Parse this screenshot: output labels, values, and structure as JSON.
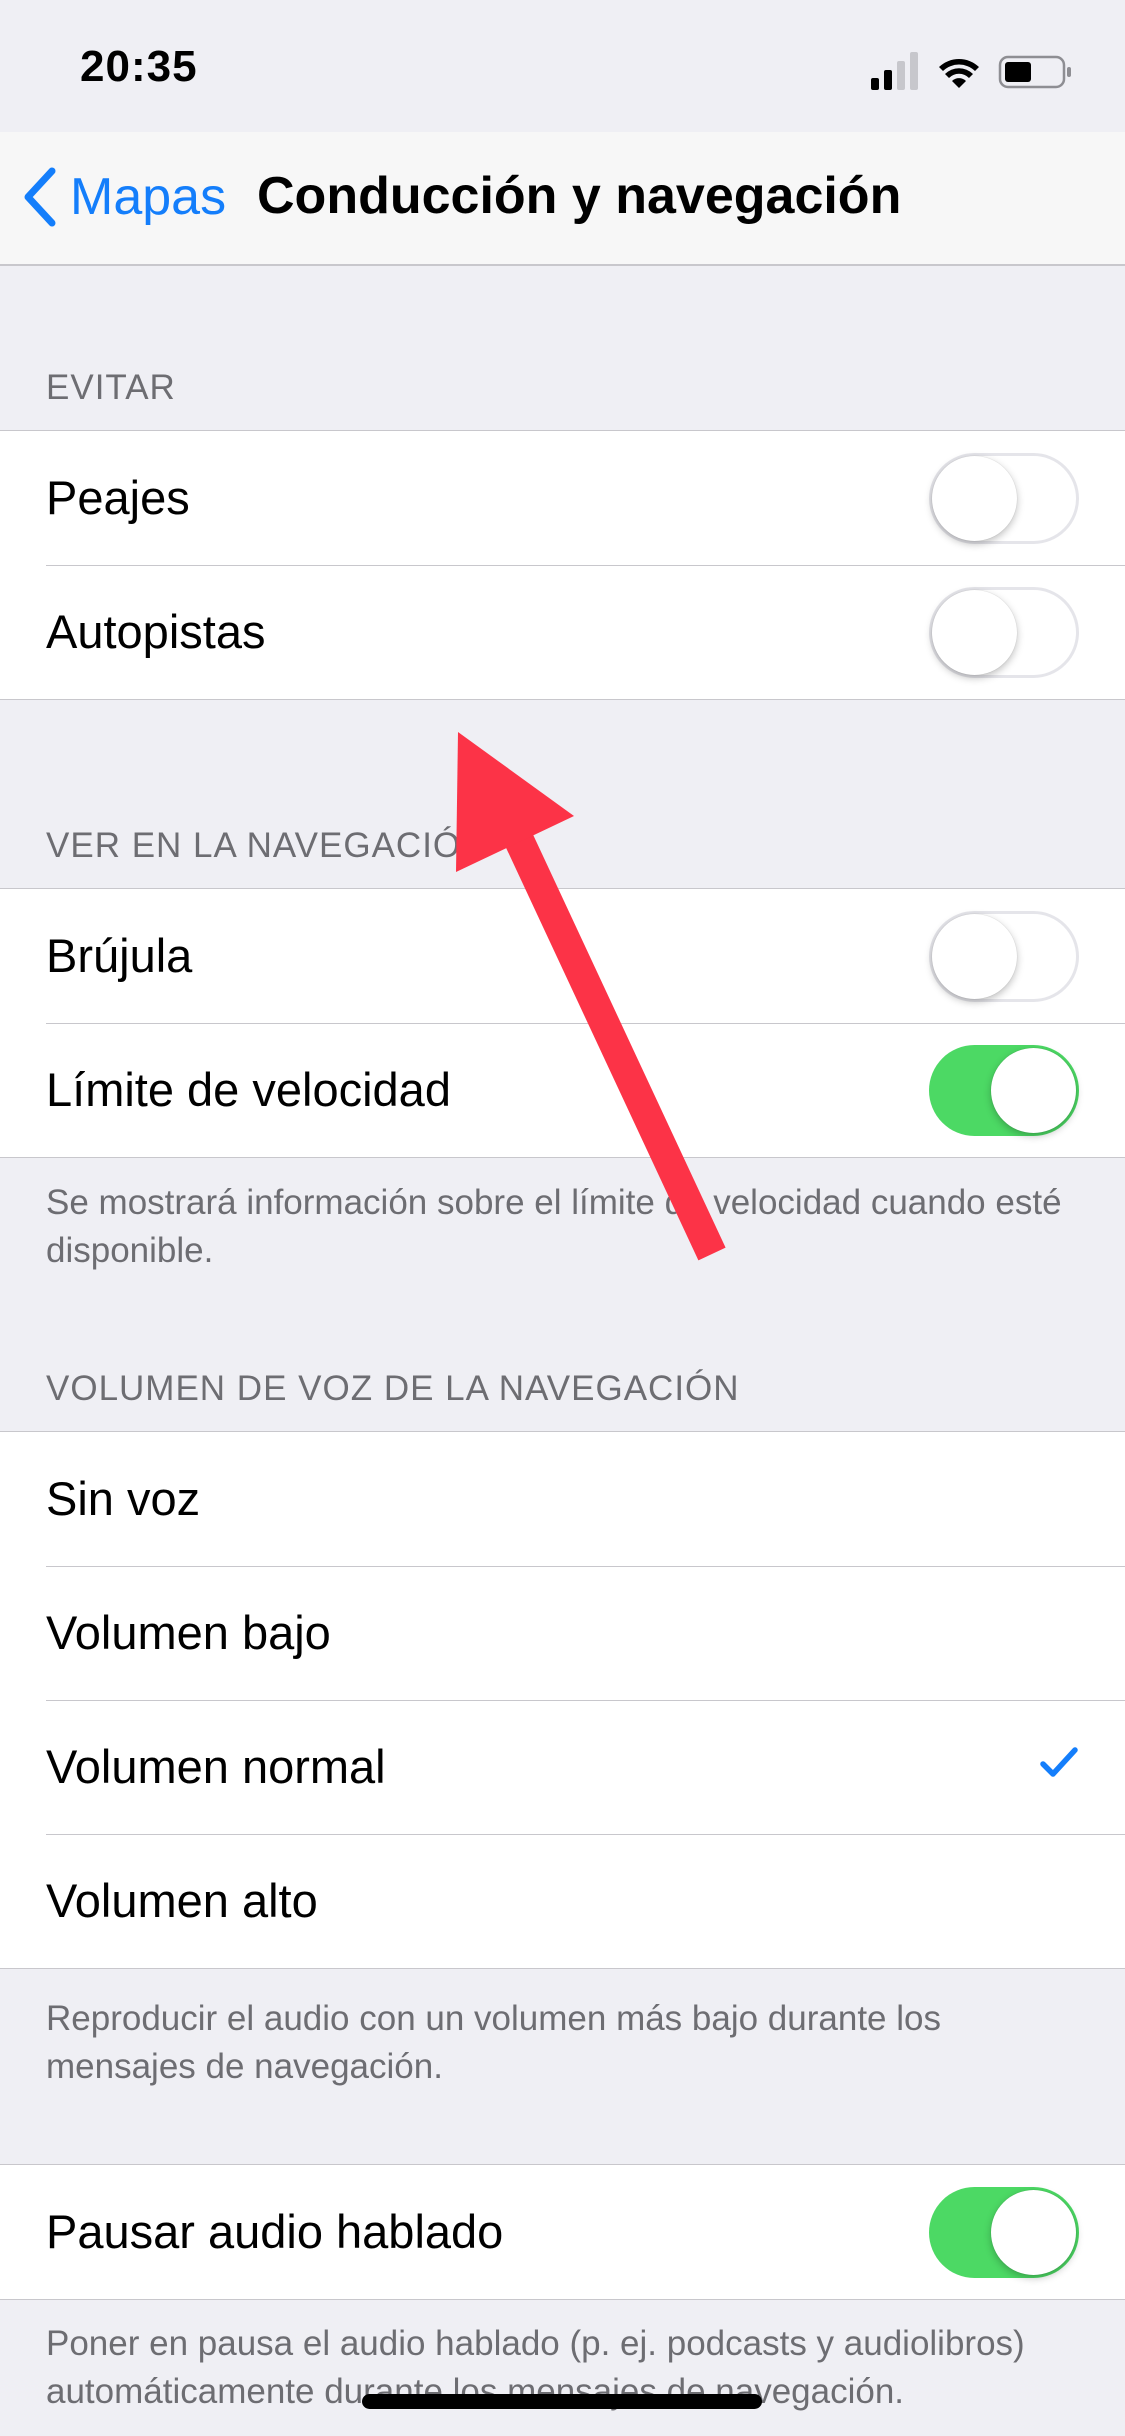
{
  "status_bar": {
    "time": "20:35"
  },
  "nav": {
    "back_label": "Mapas",
    "title": "Conducción y navegación"
  },
  "sections": {
    "avoid": {
      "header": "EVITAR",
      "rows": [
        {
          "label": "Peajes",
          "toggle": "off"
        },
        {
          "label": "Autopistas",
          "toggle": "off"
        }
      ]
    },
    "show": {
      "header": "VER EN LA NAVEGACIÓN",
      "rows": [
        {
          "label": "Brújula",
          "toggle": "off"
        },
        {
          "label": "Límite de velocidad",
          "toggle": "on"
        }
      ],
      "footer": "Se mostrará información sobre el límite de velocidad cuando esté disponible."
    },
    "volume": {
      "header": "VOLUMEN DE VOZ DE LA NAVEGACIÓN",
      "options": [
        {
          "label": "Sin voz",
          "selected": false
        },
        {
          "label": "Volumen bajo",
          "selected": false
        },
        {
          "label": "Volumen normal",
          "selected": true
        },
        {
          "label": "Volumen alto",
          "selected": false
        }
      ],
      "footer": "Reproducir el audio con un volumen más bajo durante los mensajes de navegación."
    },
    "pause": {
      "rows": [
        {
          "label": "Pausar audio hablado",
          "toggle": "on"
        }
      ],
      "footer": "Poner en pausa el audio hablado (p. ej. podcasts y audiolibros) automáticamente durante los mensajes de navegación."
    }
  },
  "colors": {
    "accent": "#147efb",
    "toggle_on": "#4cd964",
    "background": "#efeff4",
    "annotation_arrow": "#fc3347"
  }
}
